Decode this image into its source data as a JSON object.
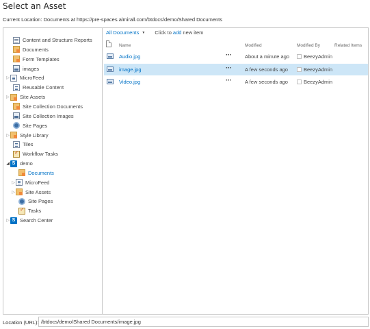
{
  "dialog": {
    "title": "Select an Asset",
    "current_location_label": "Current Location:",
    "current_location_text": "Documents at https://pre-spaces.almirall.com/btdocs/demo/Shared Documents"
  },
  "tree": {
    "items": [
      {
        "label": "Content and Structure Reports",
        "icon": "page-icon",
        "arrow": ""
      },
      {
        "label": "Documents",
        "icon": "folder-icon",
        "arrow": ""
      },
      {
        "label": "Form Templates",
        "icon": "folder-icon",
        "arrow": ""
      },
      {
        "label": "images",
        "icon": "image-library-icon",
        "arrow": ""
      },
      {
        "label": "MicroFeed",
        "icon": "list-icon",
        "arrow": "collapsed"
      },
      {
        "label": "Reusable Content",
        "icon": "list-icon",
        "arrow": ""
      },
      {
        "label": "Site Assets",
        "icon": "folder-icon",
        "arrow": "collapsed"
      },
      {
        "label": "Site Collection Documents",
        "icon": "folder-icon",
        "arrow": ""
      },
      {
        "label": "Site Collection Images",
        "icon": "image-library-icon",
        "arrow": ""
      },
      {
        "label": "Site Pages",
        "icon": "gear-icon",
        "arrow": ""
      },
      {
        "label": "Style Library",
        "icon": "folder-icon",
        "arrow": "collapsed"
      },
      {
        "label": "Tiles",
        "icon": "list-icon",
        "arrow": ""
      },
      {
        "label": "Workflow Tasks",
        "icon": "task-icon",
        "arrow": ""
      },
      {
        "label": "demo",
        "icon": "sharepoint-site-icon",
        "arrow": "expanded"
      },
      {
        "label": "Documents",
        "icon": "folder-icon",
        "arrow": "",
        "selected": true
      },
      {
        "label": "MicroFeed",
        "icon": "list-icon",
        "arrow": "collapsed"
      },
      {
        "label": "Site Assets",
        "icon": "folder-icon",
        "arrow": "collapsed"
      },
      {
        "label": "Site Pages",
        "icon": "gear-icon",
        "arrow": ""
      },
      {
        "label": "Tasks",
        "icon": "task-icon",
        "arrow": ""
      },
      {
        "label": "Search Center",
        "icon": "sharepoint-site-icon",
        "arrow": "collapsed"
      }
    ],
    "footer_dash": "–"
  },
  "toolbar": {
    "view_label": "All Documents",
    "click_text_before": "Click to",
    "add_link": "add",
    "click_text_after": "new item"
  },
  "table": {
    "headers": {
      "name": "Name",
      "modified": "Modified",
      "modified_by": "Modified By",
      "related_items": "Related Items"
    },
    "rows": [
      {
        "name": "Audio.jpg",
        "menu": "···",
        "modified": "About a minute ago",
        "modified_by": "BeezyAdmin",
        "selected": false
      },
      {
        "name": "image.jpg",
        "menu": "···",
        "modified": "A few seconds ago",
        "modified_by": "BeezyAdmin",
        "selected": true
      },
      {
        "name": "Video.jpg",
        "menu": "···",
        "modified": "A few seconds ago",
        "modified_by": "BeezyAdmin",
        "selected": false
      }
    ]
  },
  "location": {
    "label": "Location (URL):",
    "value": "/btdocs/demo/Shared Documents/image.jpg"
  },
  "colors": {
    "link": "#0072c6",
    "selected_row": "#cde6f7",
    "border": "#c6c6c6"
  }
}
